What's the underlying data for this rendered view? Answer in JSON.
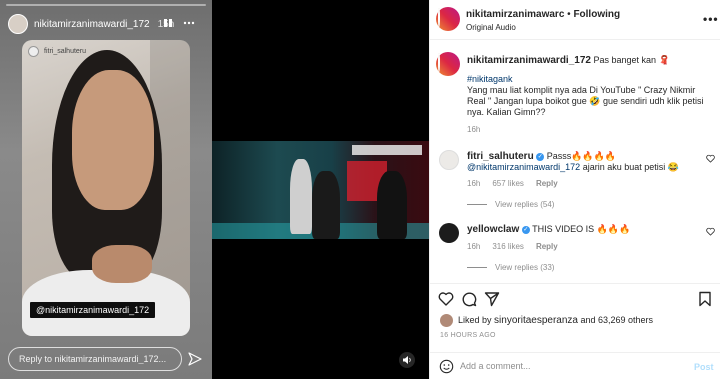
{
  "story": {
    "username": "nikitamirzanimawardi_172",
    "time": "15h",
    "inner_username": "fitri_salhuteru",
    "mention_tag": "@nikitamirzanimawardi_172",
    "reply_placeholder": "Reply to nikitamirzanimawardi_172...",
    "progress": 0
  },
  "post": {
    "author": "nikitamirzanimawarc",
    "following_label": "Following",
    "audio_label": "Original Audio",
    "caption": {
      "username": "nikitamirzanimawardi_172",
      "text": "Pas banget kan 🧣",
      "hashtag": "#nikitagank",
      "body": "Yang mau liat komplit nya ada Di YouTube \" Crazy Nikmir Real \" Jangan lupa boikot gue 🤣 gue sendiri udh klik petisi nya. Kalian Gimn??",
      "time": "16h"
    },
    "comments": [
      {
        "username": "fitri_salhuteru",
        "text": "Passs🔥🔥🔥🔥",
        "mention": "@nikitamirzanimawardi_172",
        "text2": "ajarin aku buat petisi 😂",
        "time": "16h",
        "likes": "657 likes",
        "reply_label": "Reply",
        "view_replies": "View replies (54)"
      },
      {
        "username": "yellowclaw",
        "text": "THIS VIDEO IS 🔥🔥🔥",
        "time": "16h",
        "likes": "316 likes",
        "reply_label": "Reply",
        "view_replies": "View replies (33)"
      }
    ],
    "liked_by_prefix": "Liked by",
    "liked_by_user": "sinyoritaesperanza",
    "liked_by_suffix": "and 63,269 others",
    "posted_ago": "16 HOURS AGO",
    "add_comment_placeholder": "Add a comment...",
    "post_label": "Post"
  }
}
